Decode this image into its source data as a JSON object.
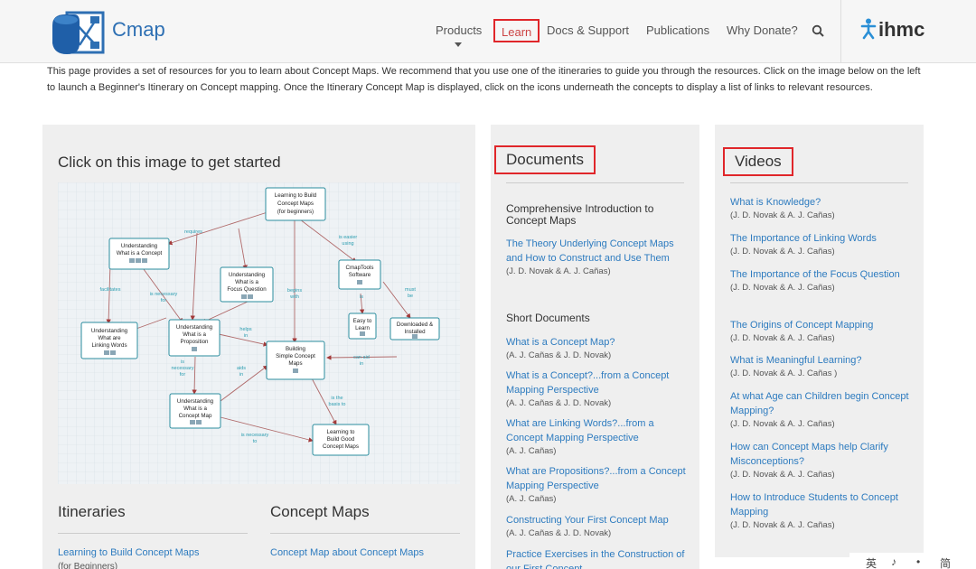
{
  "header": {
    "brand": "Cmap",
    "nav": {
      "products": "Products",
      "learn": "Learn",
      "docs": "Docs & Support",
      "publications": "Publications",
      "donate": "Why Donate?"
    },
    "org": "ihmc"
  },
  "intro": "This page provides a set of resources for you to learn about Concept Maps. We recommend that you use one of the itineraries to guide you through the resources. Click on the image below on the left to launch a Beginner's Itinerary on Concept mapping. Once the Itinerary Concept Map is displayed, click on the icons underneath the concepts to display a list of links to relevant resources.",
  "left": {
    "heading": "Click on this image to get started",
    "itineraries": {
      "heading": "Itineraries",
      "link": "Learning to Build Concept Maps",
      "sub": "(for Beginners)"
    },
    "concept_maps": {
      "heading": "Concept Maps",
      "link": "Concept Map about Concept Maps"
    }
  },
  "map": {
    "nodes": {
      "root": [
        "Learning to Build",
        "Concept Maps",
        "(for beginners)"
      ],
      "uconcept": [
        "Understanding",
        "What is a Concept"
      ],
      "cmaptools": [
        "CmapTools",
        "Software"
      ],
      "focus": [
        "Understanding",
        "What is a",
        "Focus Question"
      ],
      "linking": [
        "Understanding",
        "What are",
        "Linking Words"
      ],
      "proposition": [
        "Understanding",
        "What is a",
        "Proposition"
      ],
      "easy": [
        "Easy to",
        "Learn"
      ],
      "downloaded": [
        "Downloaded &",
        "Installed"
      ],
      "building": [
        "Building",
        "Simple Concept",
        "Maps"
      ],
      "ucmap": [
        "Understanding",
        "What is a",
        "Concept Map"
      ],
      "good": [
        "Learning to",
        "Build Good",
        "Concept Maps"
      ]
    },
    "links": {
      "requires": "requires",
      "easier": [
        "is easier",
        "using"
      ],
      "facilitates": "facilitates",
      "necessary_for": [
        "is necessary",
        "for"
      ],
      "begins": [
        "begins",
        "with"
      ],
      "is": "is",
      "must": [
        "must",
        "be"
      ],
      "helps": [
        "helps",
        "in"
      ],
      "can_aid": [
        "can aid",
        "in"
      ],
      "is_nec": [
        "is",
        "necessary",
        "for"
      ],
      "aids": [
        "aids",
        "in"
      ],
      "basis": [
        "is the",
        "basis to"
      ],
      "nec_to": [
        "is necessary",
        "to"
      ]
    }
  },
  "documents": {
    "heading": "Documents",
    "comprehensive": "Comprehensive Introduction to Concept Maps",
    "theory": {
      "title": "The Theory Underlying Concept Maps and How to Construct and Use Them",
      "authors": "(J. D. Novak & A. J. Cañas)"
    },
    "short_heading": "Short Documents",
    "items": [
      {
        "title": "What is a Concept Map?",
        "authors": "(A. J. Cañas & J. D. Novak)"
      },
      {
        "title": "What is a Concept?...from a Concept Mapping Perspective",
        "authors": "(A. J. Cañas & J. D. Novak)"
      },
      {
        "title": "What are Linking Words?...from a Concept Mapping Perspective",
        "authors": "(A. J. Cañas)"
      },
      {
        "title": "What are Propositions?...from a Concept Mapping Perspective",
        "authors": "(A. J. Cañas)"
      },
      {
        "title": "Constructing Your First Concept Map",
        "authors": "(A. J. Cañas & J. D. Novak)"
      },
      {
        "title": "Practice Exercises in the Construction of our First Concept",
        "authors": ""
      }
    ]
  },
  "videos": {
    "heading": "Videos",
    "items": [
      {
        "title": "What is Knowledge?",
        "authors": "(J. D. Novak & A. J. Cañas)"
      },
      {
        "title": "The Importance of Linking Words",
        "authors": "(J. D. Novak & A. J. Cañas)"
      },
      {
        "title": "The Importance of the Focus Question",
        "authors": "(J. D. Novak & A. J. Cañas)"
      },
      {
        "title": "The Origins of Concept Mapping",
        "authors": "(J. D. Novak & A. J. Cañas)"
      },
      {
        "title": "What is Meaningful Learning?",
        "authors": "(J. D. Novak & A. J. Cañas )"
      },
      {
        "title": "At what Age can Children begin Concept Mapping?",
        "authors": "(J. D. Novak & A. J. Cañas)"
      },
      {
        "title": "How can Concept Maps help Clarify Misconceptions?",
        "authors": "(J. D. Novak & A. J. Cañas)"
      },
      {
        "title": "How to Introduce Students to Concept Mapping",
        "authors": "(J. D. Novak & A. J. Cañas)"
      }
    ]
  },
  "tray": [
    "英",
    "♪",
    "•",
    "简"
  ],
  "colors": {
    "link": "#2d7bbf",
    "highlight": "#e0262a",
    "node_border": "#2b8c9e",
    "link_label": "#2b9db0",
    "arrow": "#a33a3a"
  }
}
